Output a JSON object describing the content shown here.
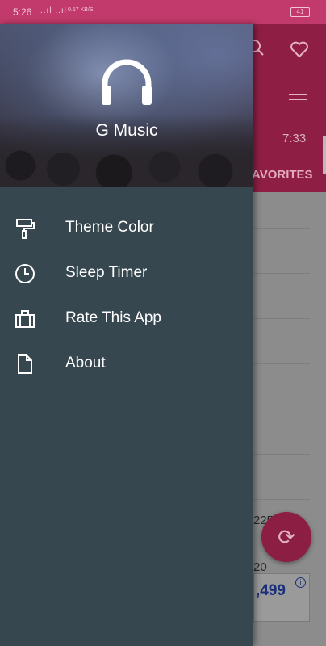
{
  "status_bar": {
    "time": "5:26",
    "signal": "..ıl ..ıl",
    "network": "0.57 KB/S",
    "battery": "41"
  },
  "background_app": {
    "tab_favorites": "AVORITES",
    "duration": "7:33",
    "row_number_1": "2251",
    "row_number_2": "20",
    "ad_price": ",499",
    "ad_info": "i",
    "fab_icon": "⟳",
    "search_icon": "search-icon",
    "heart_icon": "heart-icon",
    "shuffle_icon": "shuffle-icon"
  },
  "drawer": {
    "header": {
      "app_title": "G Music",
      "logo_icon": "headphones-icon"
    },
    "items": [
      {
        "label": "Theme Color",
        "icon": "paint-roller-icon"
      },
      {
        "label": "Sleep Timer",
        "icon": "clock-icon"
      },
      {
        "label": "Rate This App",
        "icon": "briefcase-icon"
      },
      {
        "label": "About",
        "icon": "document-icon"
      }
    ]
  },
  "colors": {
    "accent": "#c23a6b",
    "drawer_bg": "#37474f",
    "text": "#ffffff"
  }
}
